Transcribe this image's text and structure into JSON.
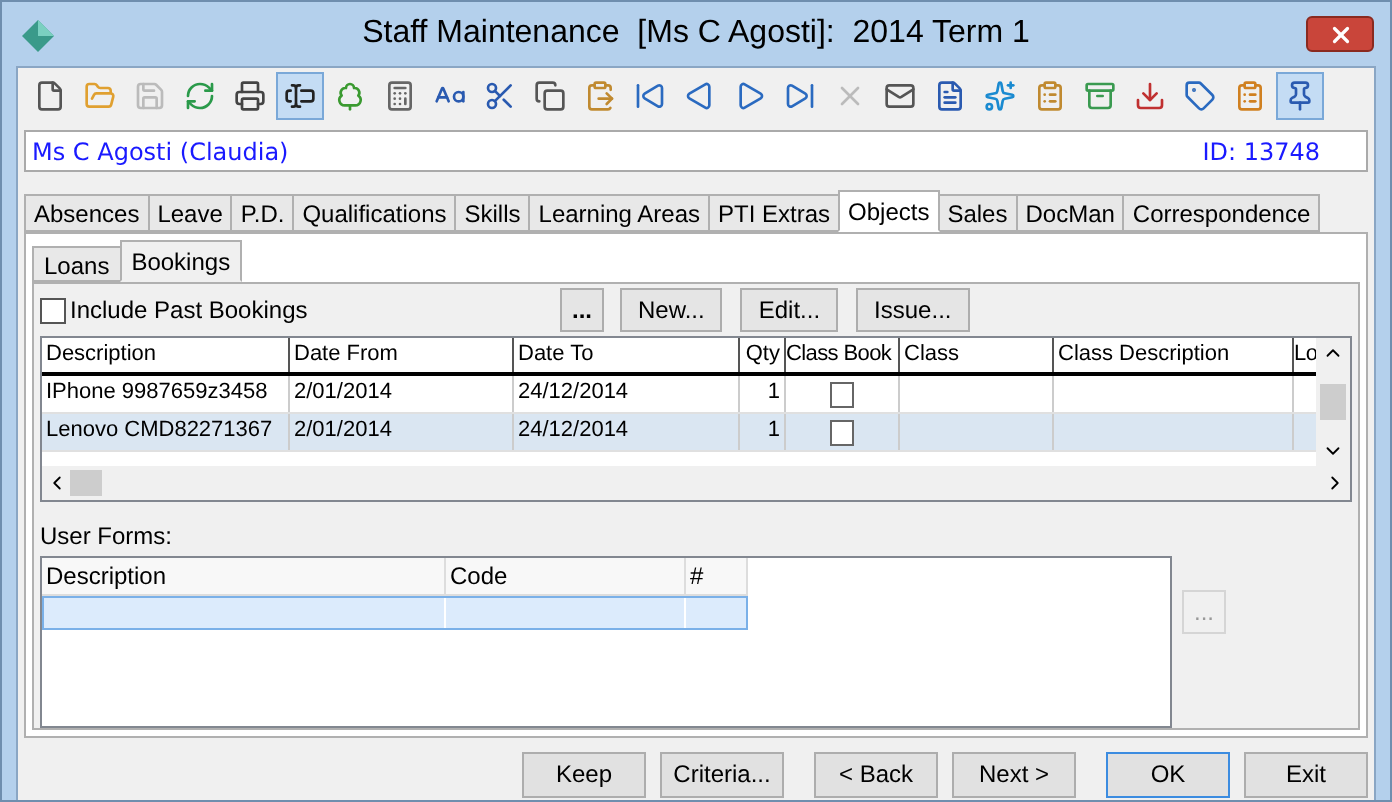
{
  "window": {
    "title": "Staff Maintenance  [Ms C Agosti]:  2014 Term 1"
  },
  "toolbar": [
    {
      "selected": false,
      "disabled": false
    },
    {
      "selected": false,
      "disabled": false
    },
    {
      "selected": false,
      "disabled": true
    },
    {
      "selected": false,
      "disabled": false
    },
    {
      "selected": false,
      "disabled": false
    },
    {
      "selected": true,
      "disabled": false
    },
    {
      "selected": false,
      "disabled": false
    },
    {
      "selected": false,
      "disabled": false
    },
    {
      "selected": false,
      "disabled": false
    },
    {
      "selected": false,
      "disabled": false
    },
    {
      "selected": false,
      "disabled": false
    },
    {
      "selected": false,
      "disabled": false
    },
    {
      "selected": false,
      "disabled": false
    },
    {
      "selected": false,
      "disabled": false
    },
    {
      "selected": false,
      "disabled": false
    },
    {
      "selected": false,
      "disabled": false
    },
    {
      "selected": false,
      "disabled": true
    },
    {
      "selected": false,
      "disabled": false
    },
    {
      "selected": false,
      "disabled": false
    },
    {
      "selected": false,
      "disabled": false
    },
    {
      "selected": false,
      "disabled": false
    },
    {
      "selected": false,
      "disabled": false
    },
    {
      "selected": false,
      "disabled": false
    },
    {
      "selected": false,
      "disabled": false
    },
    {
      "selected": false,
      "disabled": false
    },
    {
      "selected": true,
      "disabled": false
    }
  ],
  "staff": {
    "name": "Ms C Agosti (Claudia)",
    "id": "ID: 13748"
  },
  "tabs": [
    {
      "label": "Absences",
      "selected": false
    },
    {
      "label": "Leave",
      "selected": false
    },
    {
      "label": "P.D.",
      "selected": false
    },
    {
      "label": "Qualifications",
      "selected": false
    },
    {
      "label": "Skills",
      "selected": false
    },
    {
      "label": "Learning Areas",
      "selected": false
    },
    {
      "label": "PTI Extras",
      "selected": false
    },
    {
      "label": "Objects",
      "selected": true
    },
    {
      "label": "Sales",
      "selected": false
    },
    {
      "label": "DocMan",
      "selected": false
    },
    {
      "label": "Correspondence",
      "selected": false
    }
  ],
  "subtabs": [
    {
      "label": "Loans",
      "selected": false
    },
    {
      "label": "Bookings",
      "selected": true
    }
  ],
  "include_past": {
    "label": "Include Past Bookings",
    "checked": false
  },
  "actions": [
    "...",
    "New...",
    "Edit...",
    "Issue..."
  ],
  "bookings": {
    "columns": [
      "Description",
      "Date From",
      "Date To",
      "Qty",
      "Class Book",
      "Class",
      "Class Description",
      "Lo"
    ],
    "rows": [
      {
        "description": "IPhone 9987659z3458",
        "date_from": "2/01/2014",
        "date_to": "24/12/2014",
        "qty": "1",
        "class_book": false,
        "selected": false
      },
      {
        "description": "Lenovo CMD82271367",
        "date_from": "2/01/2014",
        "date_to": "24/12/2014",
        "qty": "1",
        "class_book": false,
        "selected": true
      }
    ]
  },
  "user_forms": {
    "label": "User Forms:",
    "columns": [
      "Description",
      "Code",
      "#"
    ],
    "rows": [
      {
        "selected": true
      }
    ],
    "more_button": {
      "label": "...",
      "disabled": true
    }
  },
  "buttons": [
    {
      "label": "Keep",
      "focused": false
    },
    {
      "label": "Criteria...",
      "focused": false
    },
    {
      "label": "< Back",
      "focused": false
    },
    {
      "label": "Next >",
      "focused": false
    },
    {
      "label": "OK",
      "focused": true
    },
    {
      "label": "Exit",
      "focused": false
    }
  ]
}
